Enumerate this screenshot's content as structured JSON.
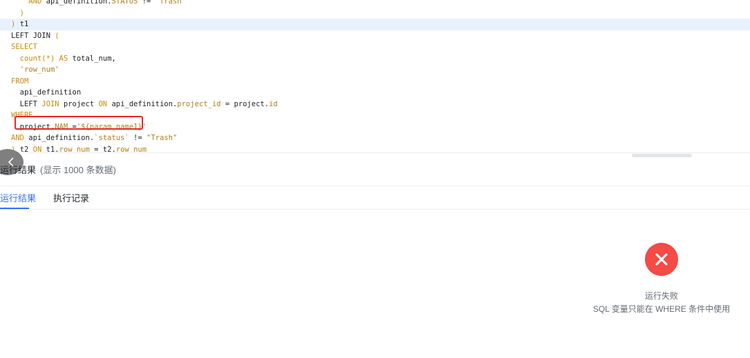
{
  "editor": {
    "lines": [
      [
        {
          "t": "    "
        },
        {
          "t": "AND",
          "c": "kw"
        },
        {
          "t": " api_definition."
        },
        {
          "t": "STATUS",
          "c": "prop"
        },
        {
          "t": " != "
        },
        {
          "t": "'Trash'",
          "c": "str"
        }
      ],
      [
        {
          "t": "  "
        },
        {
          "t": ")",
          "c": "kw"
        }
      ],
      [
        {
          "t": ") ",
          "c": "kw"
        },
        {
          "t": "t1"
        }
      ],
      [
        {
          "t": "LEFT JOIN "
        },
        {
          "t": "(",
          "c": "kw"
        }
      ],
      [
        {
          "t": "SELECT",
          "c": "kw"
        }
      ],
      [
        {
          "t": "  "
        },
        {
          "t": "count(*) AS",
          "c": "kw"
        },
        {
          "t": " total_num,"
        }
      ],
      [
        {
          "t": "  "
        },
        {
          "t": "'row_num'",
          "c": "str"
        }
      ],
      [
        {
          "t": "FROM",
          "c": "kw"
        }
      ],
      [
        {
          "t": "  api_definition"
        }
      ],
      [
        {
          "t": "  LEFT "
        },
        {
          "t": "JOIN",
          "c": "kw"
        },
        {
          "t": " project "
        },
        {
          "t": "ON",
          "c": "kw"
        },
        {
          "t": " api_definition."
        },
        {
          "t": "project_id",
          "c": "prop"
        },
        {
          "t": " = project."
        },
        {
          "t": "id",
          "c": "prop"
        }
      ],
      [
        {
          "t": "WHERE",
          "c": "kw"
        }
      ],
      [
        {
          "t": "  project."
        },
        {
          "t": "NAM",
          "c": "prop"
        },
        {
          "t": " ="
        },
        {
          "t": "'${param_name1}'",
          "c": "str"
        }
      ],
      [
        {
          "t": "AND",
          "c": "kw"
        },
        {
          "t": " api_definition."
        },
        {
          "t": "`status`",
          "c": "str"
        },
        {
          "t": " != "
        },
        {
          "t": "\"Trash\"",
          "c": "str"
        }
      ],
      [
        {
          "t": ") ",
          "c": "kw"
        },
        {
          "t": "t2 "
        },
        {
          "t": "ON",
          "c": "kw"
        },
        {
          "t": " t1."
        },
        {
          "t": "row_num",
          "c": "prop"
        },
        {
          "t": " = t2."
        },
        {
          "t": "row_num",
          "c": "prop"
        }
      ]
    ],
    "active_line": 2
  },
  "panel": {
    "title": "运行结果",
    "subtitle": "(显示 1000 条数据)"
  },
  "tabs": [
    {
      "label": "运行结果",
      "active": true
    },
    {
      "label": "执行记录",
      "active": false
    }
  ],
  "result": {
    "status_title": "运行失败",
    "message": "SQL 变量只能在 WHERE 条件中使用"
  },
  "colors": {
    "accent": "#3370ff",
    "error": "#f54a45",
    "highlight_border": "#e8252a"
  },
  "icons": {
    "collapse": "chevron-left-icon",
    "error": "close-circle-icon"
  }
}
